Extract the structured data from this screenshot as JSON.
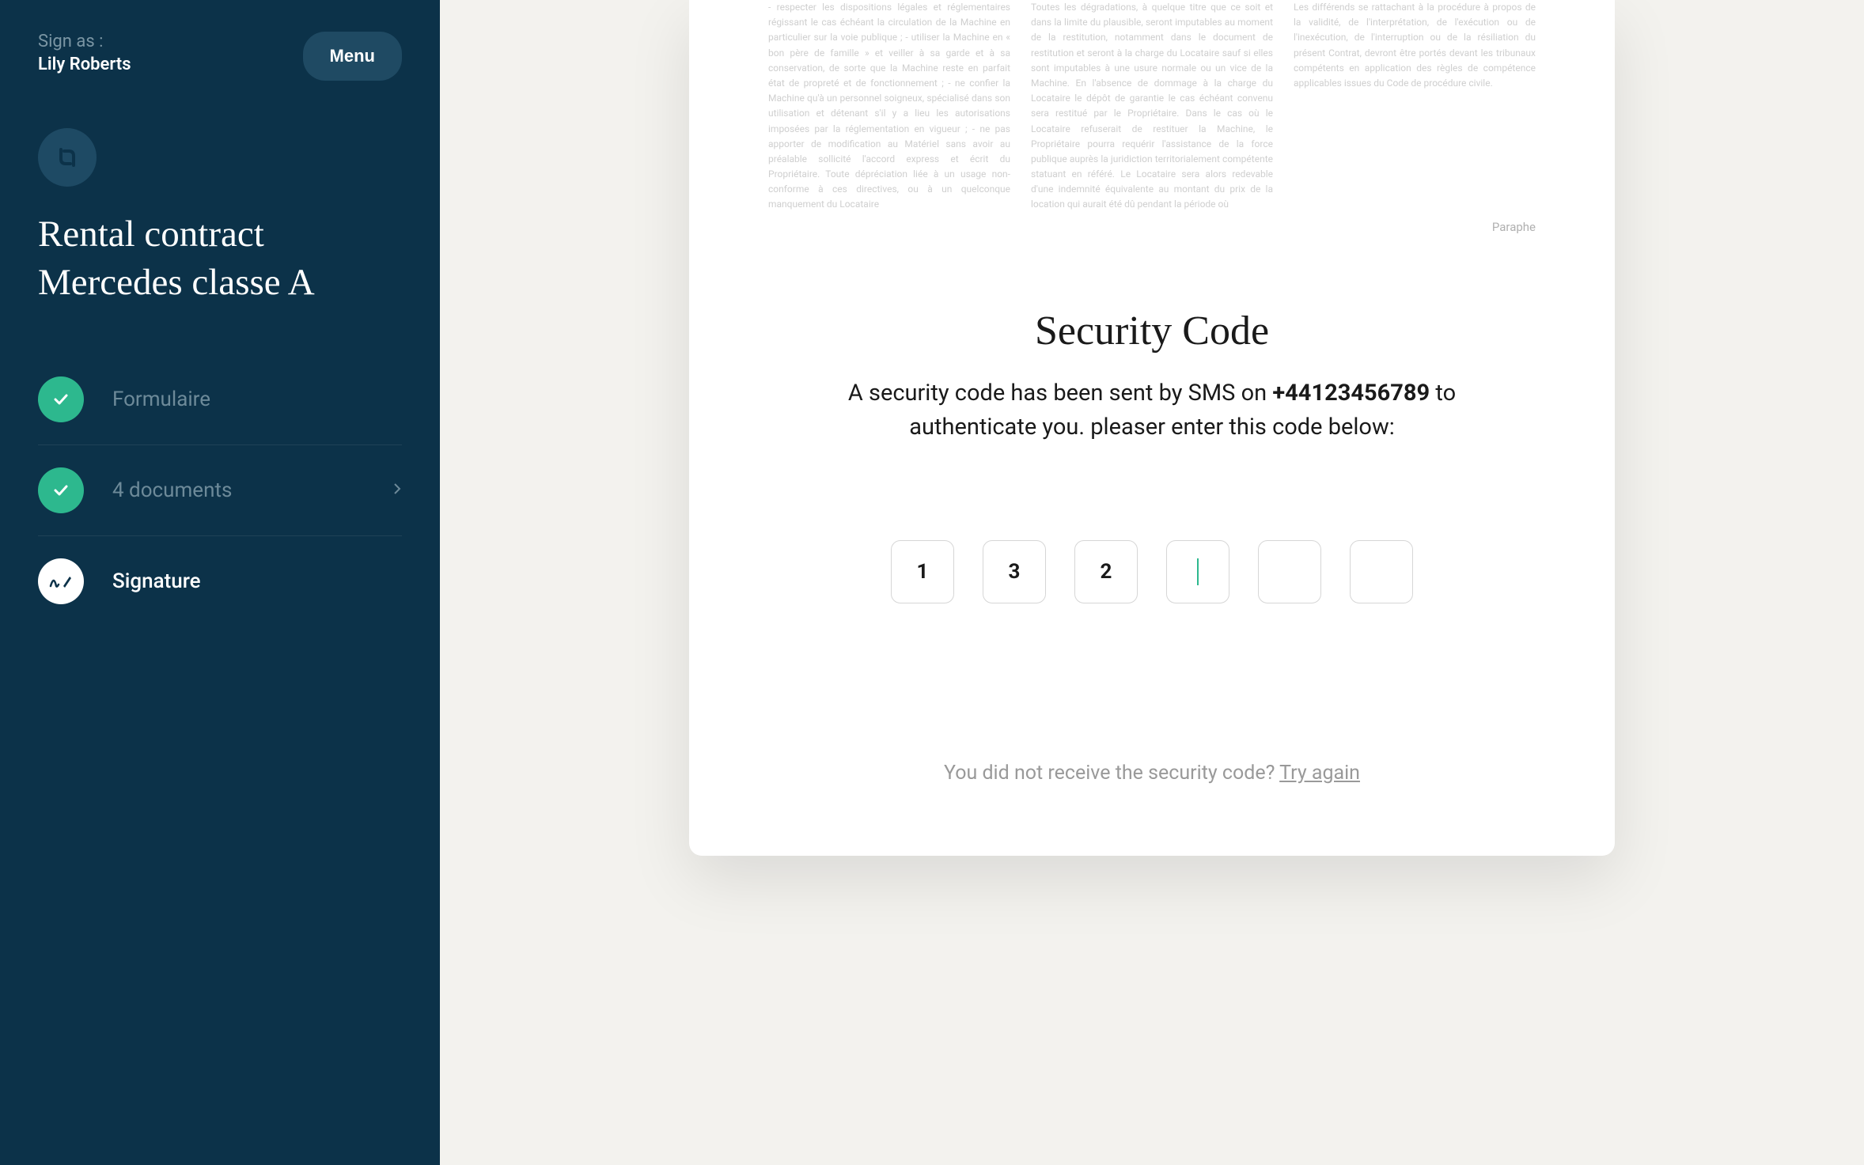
{
  "sidebar": {
    "sign_as_label": "Sign as :",
    "user_name": "Lily Roberts",
    "menu_label": "Menu",
    "contract_title_line1": "Rental contract",
    "contract_title_line2": "Mercedes classe A",
    "steps": [
      {
        "label": "Formulaire",
        "status": "done"
      },
      {
        "label": "4 documents",
        "status": "done",
        "has_chevron": true
      },
      {
        "label": "Signature",
        "status": "active"
      }
    ]
  },
  "document": {
    "paraphe_label": "Paraphe",
    "contract_text_col1": "- respecter les dispositions légales et réglementaires régissant le cas échéant la circulation de la Machine en particulier sur la voie publique ; - utiliser la Machine en « bon père de famille » et veiller à sa garde et à sa conservation, de sorte que la Machine reste en parfait état de propreté et de fonctionnement ; - ne confier la Machine qu'à un personnel soigneux, spécialisé dans son utilisation et détenant s'il y a lieu les autorisations imposées par la réglementation en vigueur ; - ne pas apporter de modification au Matériel sans avoir au préalable sollicité l'accord express et écrit du Propriétaire. Toute dépréciation liée à un usage non-conforme à ces directives, ou à un quelconque manquement du Locataire",
    "contract_text_col2": "Toutes les dégradations, à quelque titre que ce soit et dans la limite du plausible, seront imputables au moment de la restitution, notamment dans le document de restitution et seront à la charge du Locataire sauf si elles sont imputables à une usure normale ou un vice de la Machine. En l'absence de dommage à la charge du Locataire le dépôt de garantie le cas échéant convenu sera restitué par le Propriétaire. Dans le cas où le Locataire refuserait de restituer la Machine, le Propriétaire pourra requérir l'assistance de la force publique auprès la juridiction territorialement compétente statuant en référé. Le Locataire sera alors redevable d'une indemnité équivalente au montant du prix de la location qui aurait été dû pendant la période où",
    "contract_text_col3": "Les différends se rattachant à la procédure à propos de la validité, de l'interprétation, de l'exécution ou de l'inexécution, de l'interruption ou de la résiliation du présent Contrat, devront être portés devant les tribunaux compétents en application des règles de compétence applicables issues du Code de procédure civile."
  },
  "security": {
    "title": "Security Code",
    "desc_prefix": "A security code has been sent by SMS on ",
    "phone": "+44123456789",
    "desc_suffix": " to authenticate you. pleaser enter this code below:",
    "code_values": [
      "1",
      "3",
      "2",
      "",
      "",
      ""
    ],
    "cursor_index": 3,
    "not_received_text": "You did not receive the security code? ",
    "try_again_label": "Try again"
  }
}
